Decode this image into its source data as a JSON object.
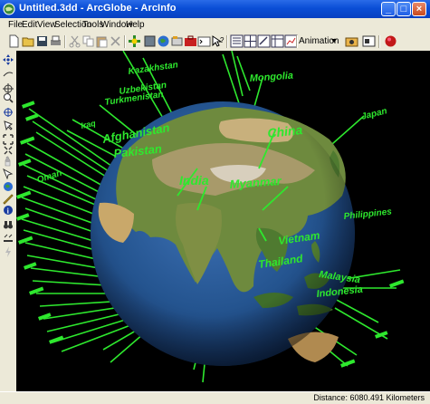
{
  "window": {
    "title": "Untitled.3dd - ArcGlobe - ArcInfo"
  },
  "menu": [
    {
      "label": "File"
    },
    {
      "label": "Edit"
    },
    {
      "label": "View"
    },
    {
      "label": "Selection"
    },
    {
      "label": "Tools"
    },
    {
      "label": "Window"
    },
    {
      "label": "Help"
    }
  ],
  "toolbar": {
    "animation_label": "Animation"
  },
  "globe_labels": {
    "kazakhstan": "Kazakhstan",
    "mongolia": "Mongolia",
    "uzbekistan": "Uzbekistan",
    "turkmenistan": "Turkmenistan",
    "iraq": "Iraq",
    "afghanistan": "Afghanistan",
    "pakistan": "Pakistan",
    "oman": "Oman",
    "india": "India",
    "china": "China",
    "japan": "Japan",
    "myanmar": "Myanmar",
    "philippines": "Philippines",
    "vietnam": "Vietnam",
    "thailand": "Thailand",
    "malaysia": "Malaysia",
    "indonesia": "Indonesia"
  },
  "status": {
    "distance": "Distance:  6080.491 Kilometers"
  },
  "colors": {
    "label_green": "#2ee82e",
    "ocean": "#1f4c8f",
    "title_blue": "#0a4ed6"
  }
}
